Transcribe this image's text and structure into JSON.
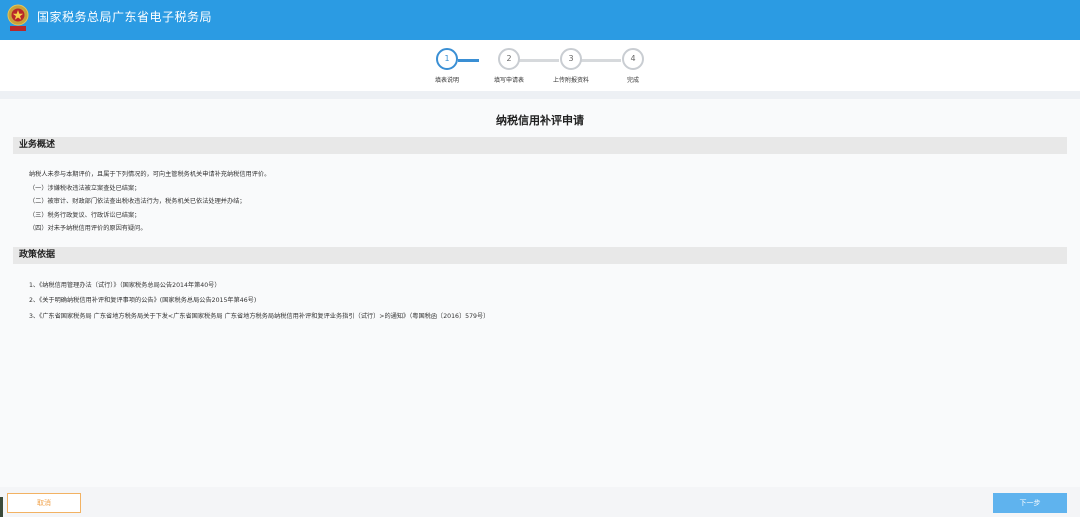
{
  "header": {
    "title": "国家税务总局广东省电子税务局",
    "logo_icon": "tax-emblem-icon",
    "background": "#2b9be3"
  },
  "steps": [
    {
      "number": "1",
      "label": "填表说明",
      "active": true
    },
    {
      "number": "2",
      "label": "填写申请表",
      "active": false
    },
    {
      "number": "3",
      "label": "上传附报资料",
      "active": false
    },
    {
      "number": "4",
      "label": "完成",
      "active": false
    }
  ],
  "page": {
    "title": "纳税信用补评申请"
  },
  "overview": {
    "heading": "业务概述",
    "intro": "纳税人未参与本期评价，且属于下列情况的，可向主管税务机关申请补充纳税信用评价。",
    "items": [
      "（一）涉嫌税收违法被立案查处已结案；",
      "（二）被审计、财政部门依法查出税收违法行为，税务机关已依法处理并办结；",
      "（三）税务行政复议、行政诉讼已结案；",
      "（四）对未予纳税信用评价的原因有疑问。"
    ]
  },
  "policy": {
    "heading": "政策依据",
    "items": [
      "1、《纳税信用管理办法（试行）》（国家税务总局公告2014年第40号）",
      "2、《关于明确纳税信用补评和复评事项的公告》(国家税务总局公告2015年第46号)",
      "3、《广东省国家税务局 广东省地方税务局关于下发<广东省国家税务局 广东省地方税务局纳税信用补评和复评业务指引（试行）>的通知》（粤国税函〔2016〕579号）"
    ]
  },
  "footer": {
    "cancel_label": "取消",
    "next_label": "下一步"
  },
  "colors": {
    "accent": "#3a8fd4",
    "cancel": "#f0a24b",
    "next": "#5fb3ee"
  }
}
